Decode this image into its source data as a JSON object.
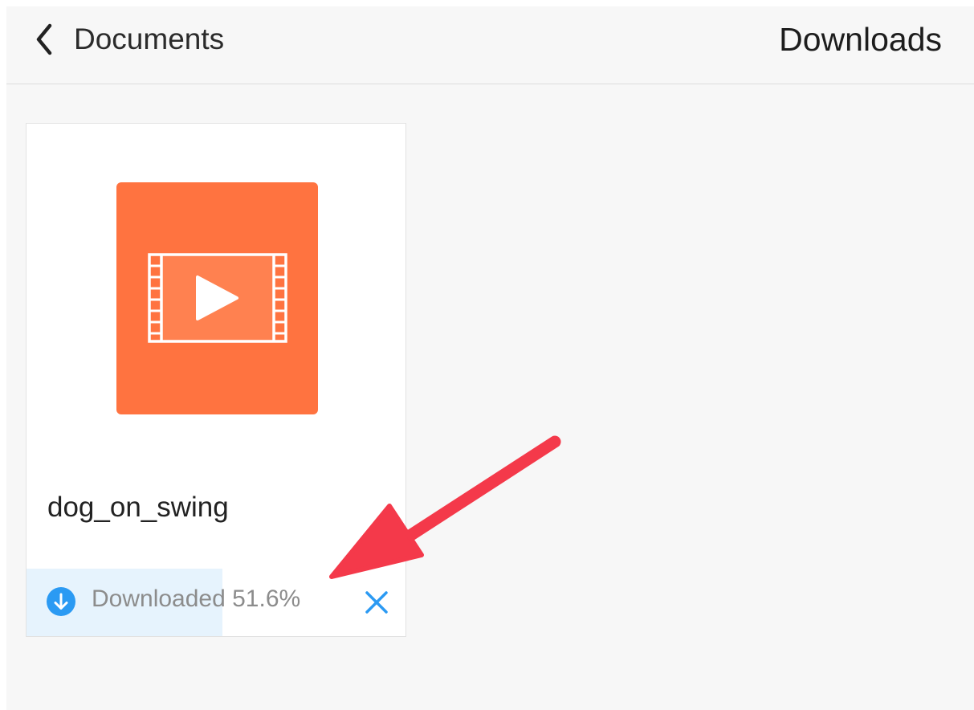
{
  "navbar": {
    "back_label": "Documents",
    "title": "Downloads",
    "back_icon": "chevron-left-icon"
  },
  "download_item": {
    "file_name": "dog_on_swing",
    "file_type_icon": "video-file-icon",
    "status_icon": "download-arrow-icon",
    "progress_text": "Downloaded 51.6%",
    "progress_percent": 51.6,
    "cancel_icon": "close-icon"
  },
  "annotation": {
    "arrow_icon": "red-arrow-annotation"
  },
  "colors": {
    "accent": "#2b9af3",
    "thumbnail": "#ff7340",
    "progress_fill": "#e6f3fd",
    "annotation": "#f4394a"
  }
}
